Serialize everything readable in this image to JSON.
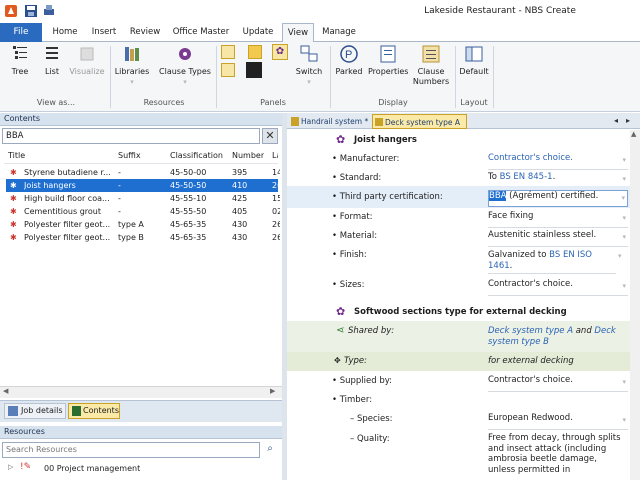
{
  "app": {
    "title": "Lakeside Restaurant - NBS Create"
  },
  "ribbon": {
    "tabs": [
      "File",
      "Home",
      "Insert",
      "Review",
      "Office Master",
      "Update",
      "View",
      "Manage"
    ],
    "active_tab": "View",
    "buttons": {
      "tree": "Tree",
      "list": "List",
      "visualize": "Visualize",
      "libraries": "Libraries",
      "clause_types": "Clause Types",
      "switch": "Switch",
      "parked": "Parked",
      "properties": "Properties",
      "clause_numbers_1": "Clause",
      "clause_numbers_2": "Numbers",
      "default": "Default"
    },
    "groups": {
      "view_as": "View as...",
      "resources": "Resources",
      "panels": "Panels",
      "display": "Display",
      "layout": "Layout"
    }
  },
  "contents": {
    "header": "Contents",
    "search_value": "BBA",
    "columns": [
      "Title",
      "Suffix",
      "Classification",
      "Number",
      "La"
    ],
    "rows": [
      {
        "title": "Styrene butadiene r...",
        "suffix": "-",
        "classification": "45-50-00",
        "number": "395",
        "la": "14"
      },
      {
        "title": "Joist hangers",
        "suffix": "-",
        "classification": "45-50-50",
        "number": "410",
        "la": "26"
      },
      {
        "title": "High build floor coa...",
        "suffix": "-",
        "classification": "45-55-10",
        "number": "425",
        "la": "15"
      },
      {
        "title": "Cementitious grout",
        "suffix": "-",
        "classification": "45-55-50",
        "number": "405",
        "la": "02"
      },
      {
        "title": "Polyester filter geot...",
        "suffix": "type A",
        "classification": "45-65-35",
        "number": "430",
        "la": "26"
      },
      {
        "title": "Polyester filter geot...",
        "suffix": "type B",
        "classification": "45-65-35",
        "number": "430",
        "la": "26"
      }
    ]
  },
  "bottom_tabs": {
    "job_details": "Job details",
    "contents": "Contents"
  },
  "resources": {
    "header": "Resources",
    "search_placeholder": "Search Resources",
    "tree_item": "00 Project management"
  },
  "doc_tabs": {
    "tab1": "Handrail system *",
    "tab2": "Deck system type A"
  },
  "clause1": {
    "heading": "Joist hangers",
    "props": [
      {
        "label": "Manufacturer:",
        "value": "Contractor's choice."
      },
      {
        "label": "Standard:",
        "value_prefix": "To ",
        "value_link": "BS EN 845-1",
        "value_suffix": "."
      },
      {
        "label": "Third party certification:",
        "value_highlight": "BBA",
        "value_rest": " (Agrément) certified."
      },
      {
        "label": "Format:",
        "value": "Face fixing"
      },
      {
        "label": "Material:",
        "value": "Austenitic stainless steel."
      },
      {
        "label": "Finish:",
        "value_prefix": "Galvanized to ",
        "value_link": "BS EN ISO 1461",
        "value_suffix": "."
      },
      {
        "label": "Sizes:",
        "value": "Contractor's choice."
      }
    ]
  },
  "clause2": {
    "heading": "Softwood sections  type for external decking",
    "shared_by_label": "Shared by:",
    "shared_by_link1": "Deck system type A",
    "shared_by_and": " and ",
    "shared_by_link2": "Deck system type B",
    "type_label": "Type:",
    "type_value": "for external decking",
    "supplied_by_label": "Supplied by:",
    "supplied_by_value": "Contractor's choice.",
    "timber_label": "Timber:",
    "species_label": "– Species:",
    "species_value": "European Redwood.",
    "quality_label": "– Quality:",
    "quality_value": "Free from decay, through splits and insect attack (including ambrosia beetle damage, unless permitted in"
  },
  "colors": {
    "accent": "#2a6bbf",
    "selection": "#1f6fd1",
    "clause_icon": "#6f2a8a"
  }
}
